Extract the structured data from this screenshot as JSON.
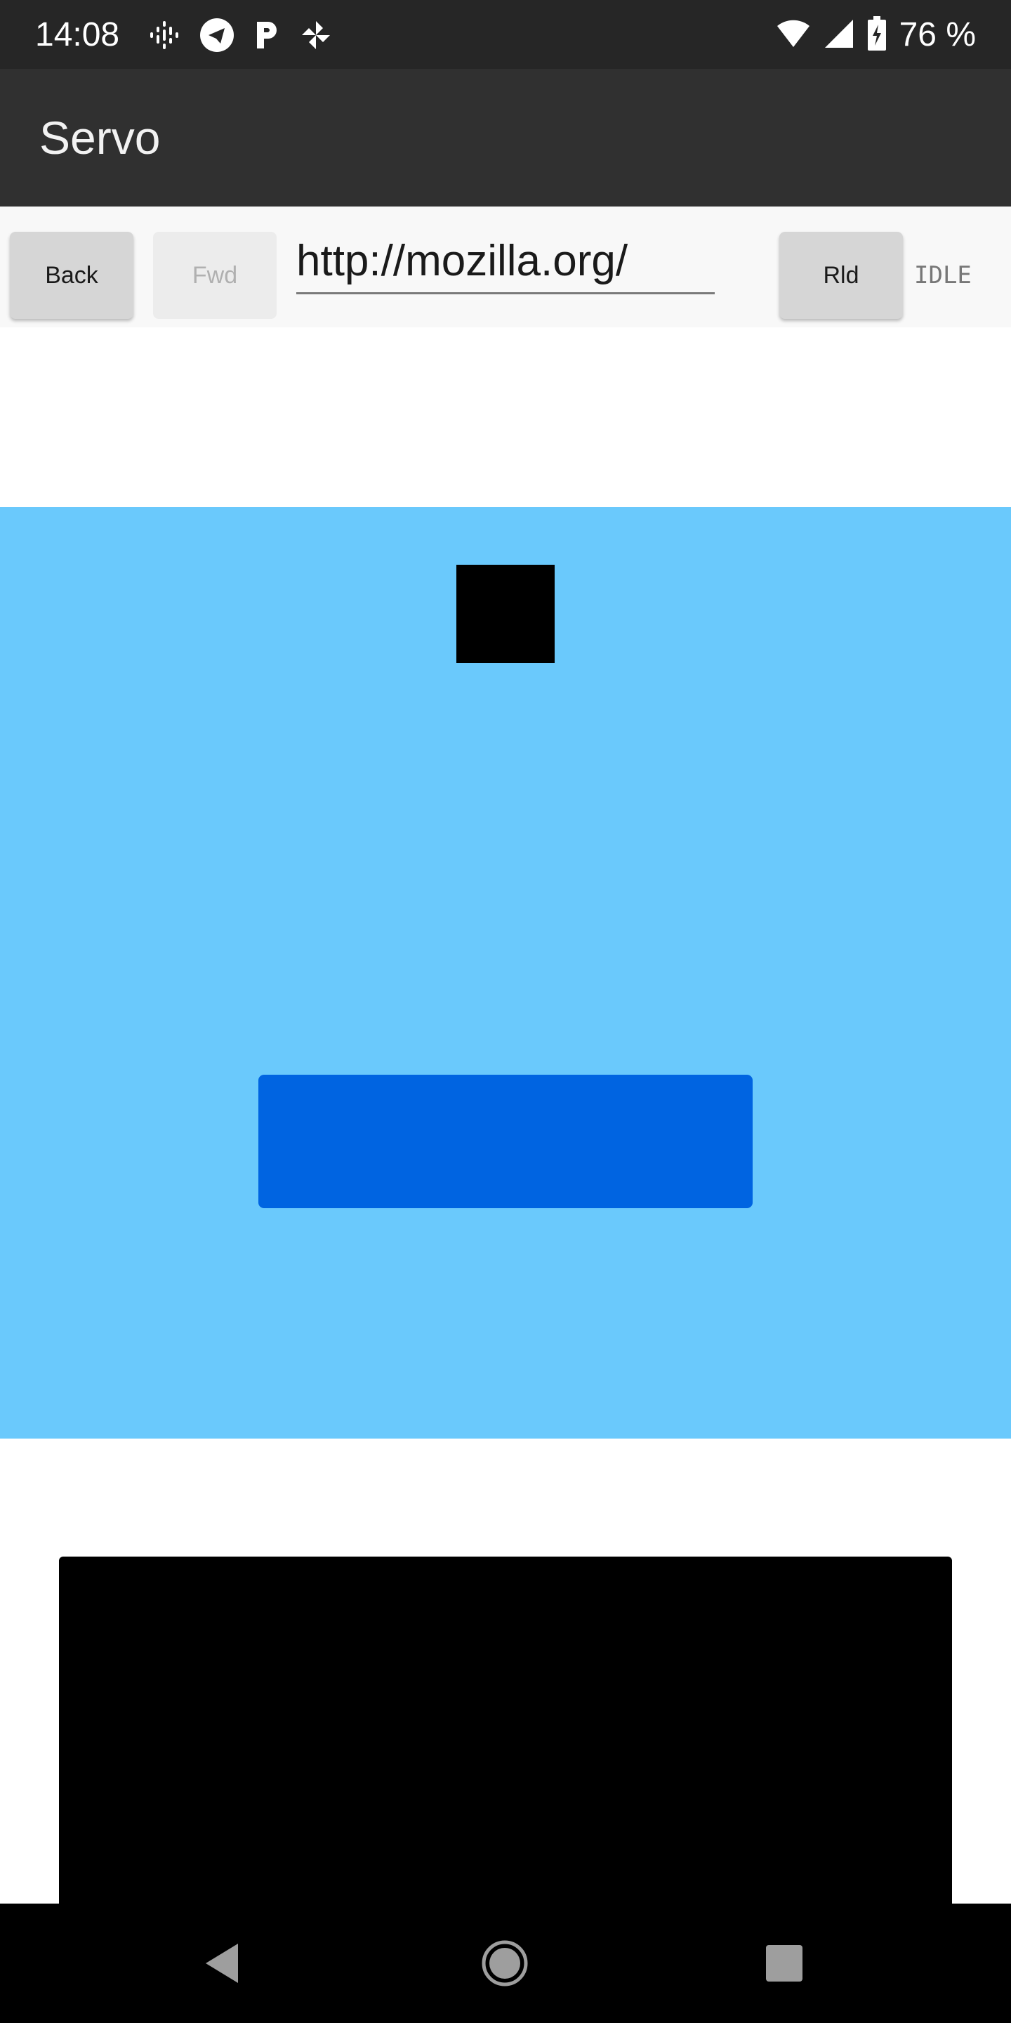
{
  "status_bar": {
    "time": "14:08",
    "battery_text": "76 %",
    "left_icons": [
      "podcast-icon",
      "telegram-icon",
      "p-letter-icon",
      "pinwheel-icon"
    ],
    "right_icons": [
      "wifi-icon",
      "cell-signal-icon",
      "battery-charging-icon"
    ]
  },
  "app_bar": {
    "title": "Servo"
  },
  "toolbar": {
    "back_label": "Back",
    "fwd_label": "Fwd",
    "url_value": "http://mozilla.org/",
    "reload_label": "Rld",
    "status": "IDLE"
  },
  "nav_bar": {
    "icons": [
      "nav-back-icon",
      "nav-home-icon",
      "nav-recents-icon"
    ]
  },
  "colors": {
    "status_bar": "#262626",
    "app_bar": "#303030",
    "toolbar": "#f8f8f8",
    "blue_section": "#6ac9fc",
    "blue_button": "#0064e1",
    "black": "#000000"
  }
}
